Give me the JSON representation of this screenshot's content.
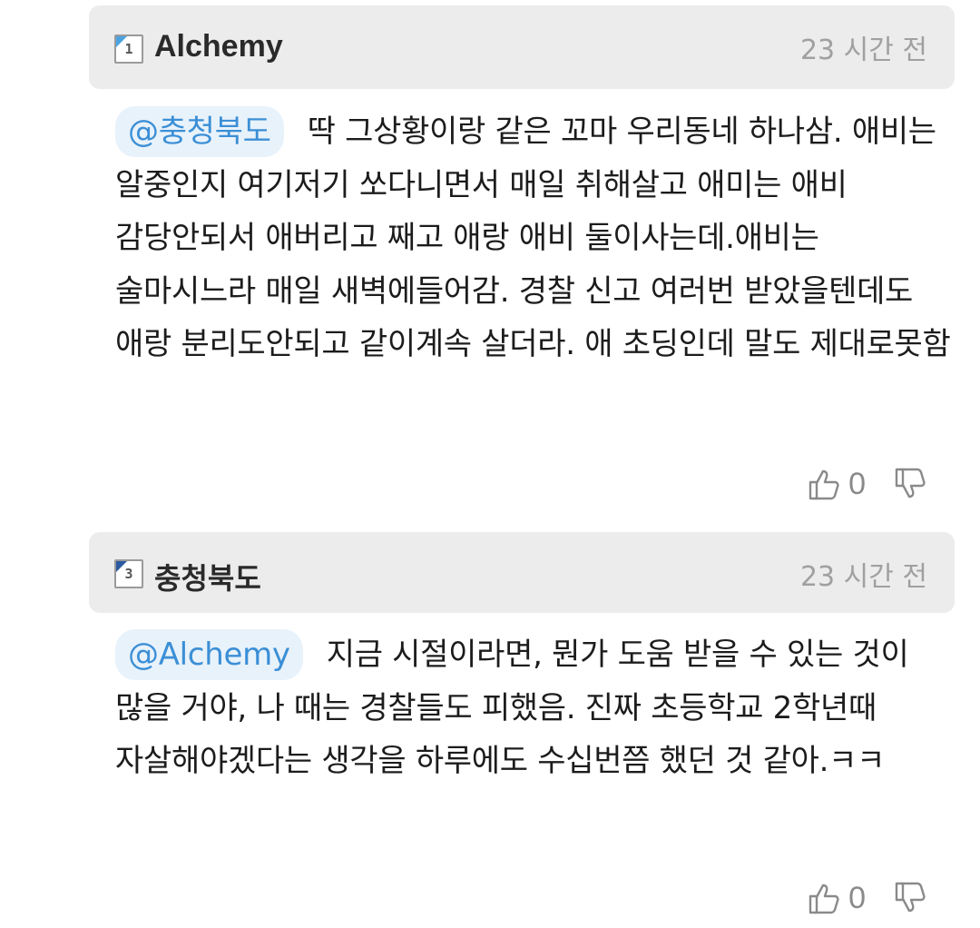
{
  "comments": [
    {
      "level": "1",
      "username": "Alchemy",
      "time": "23 시간 전",
      "mention": "@충청북도",
      "text": "딱 그상황이랑 같은 꼬마 우리동네 하나삼. 애비는 알중인지 여기저기 쏘다니면서 매일 취해살고 애미는 애비 감당안되서 애버리고 째고 애랑 애비 둘이사는데.애비는 술마시느라 매일 새벽에들어감. 경찰 신고 여러번 받았을텐데도 애랑 분리도안되고 같이계속 살더라. 애 초딩인데 말도 제대로못함",
      "likes": "0",
      "icons": {
        "like": "thumbs-up-icon",
        "dislike": "thumbs-down-icon"
      }
    },
    {
      "level": "3",
      "username": "충청북도",
      "time": "23 시간 전",
      "mention": "@Alchemy",
      "text": "지금 시절이라면, 뭔가 도움 받을 수 있는 것이 많을 거야, 나 때는 경찰들도 피했음. 진짜 초등학교 2학년때 자살해야겠다는 생각을 하루에도 수십번쯤 했던 것 같아.ㅋㅋ",
      "likes": "0",
      "icons": {
        "like": "thumbs-up-icon",
        "dislike": "thumbs-down-icon"
      }
    }
  ],
  "colors": {
    "header_bg": "#ececec",
    "mention_bg": "#e8f2fb",
    "mention_text": "#3b8fd6",
    "meta_gray": "#a0a0a0"
  }
}
